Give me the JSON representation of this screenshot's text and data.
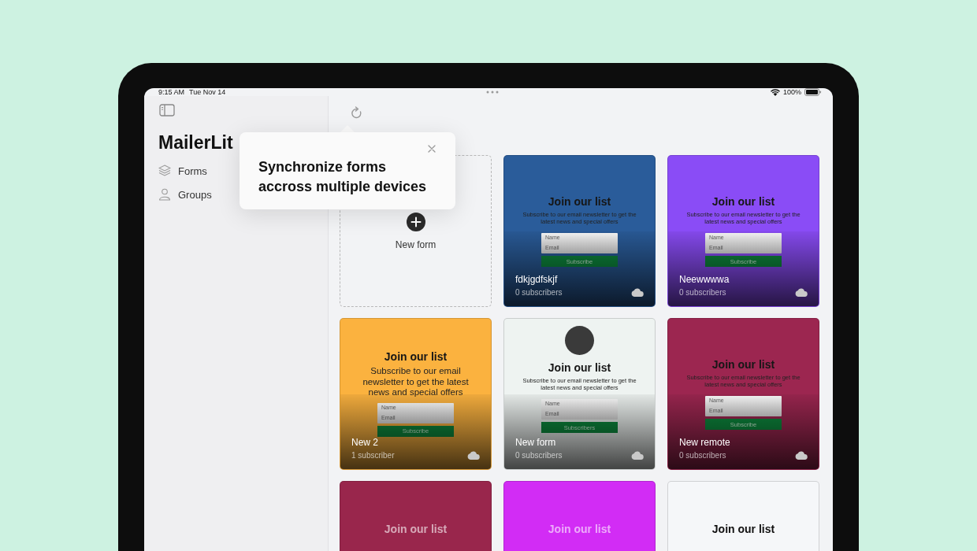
{
  "status_bar": {
    "time": "9:15 AM",
    "date": "Tue Nov 14",
    "battery": "100%"
  },
  "sidebar": {
    "title": "MailerLit",
    "items": [
      {
        "label": "Forms"
      },
      {
        "label": "Groups"
      }
    ]
  },
  "tooltip": {
    "text": "Synchronize forms accross multiple devices"
  },
  "new_form": {
    "label": "New form"
  },
  "forms": [
    {
      "kind": "compact",
      "color": "#2a5c9a",
      "title": "Join our list",
      "description": "Subscribe to our email newsletter to get the latest news and special offers",
      "name_field": "Name",
      "email_field": "Email",
      "button": "Subscribe",
      "name": "fdkjgdfskjf",
      "subscribers": "0 subscribers",
      "has_image": false
    },
    {
      "kind": "compact",
      "color": "#8a4cf6",
      "title": "Join our list",
      "description": "Subscribe to our email newsletter to get the latest news and special offers",
      "name_field": "Name",
      "email_field": "Email",
      "button": "Subscribe",
      "name": "Neewwwwa",
      "subscribers": "0 subscribers",
      "has_image": false
    },
    {
      "kind": "large",
      "color": "#fbb23f",
      "title": "Join our list",
      "description": "Subscribe to our email newsletter to get the latest news and special offers",
      "name_field": "Name",
      "email_field": "Email",
      "button": "Subscribe",
      "name": "New 2",
      "subscribers": "1 subscriber",
      "has_image": false
    },
    {
      "kind": "compact",
      "color": "#eef3f1",
      "title": "Join our list",
      "description": "Subscribe to our email newsletter to get the latest news and special offers",
      "name_field": "Name",
      "email_field": "Email",
      "button": "Subscribers",
      "name": "New form",
      "subscribers": "0 subscribers",
      "has_image": true
    },
    {
      "kind": "compact",
      "color": "#9c2650",
      "title": "Join our list",
      "description": "Subscribe to our email newsletter to get the latest news and special offers",
      "name_field": "Name",
      "email_field": "Email",
      "button": "Subscribe",
      "name": "New remote",
      "subscribers": "0 subscribers",
      "has_image": false
    },
    {
      "kind": "partial",
      "color": "#99264c",
      "title": "Join our list"
    },
    {
      "kind": "partial",
      "color": "#d22cf5",
      "title": "Join our list"
    },
    {
      "kind": "partial",
      "color": "#f5f7f9",
      "title": "Join our list"
    }
  ]
}
